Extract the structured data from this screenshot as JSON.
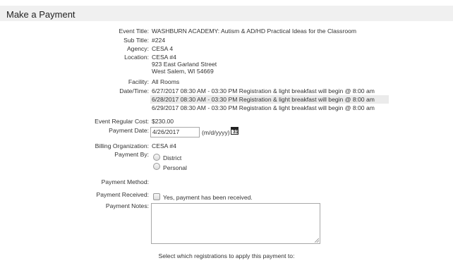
{
  "page": {
    "title": "Make a Payment"
  },
  "fields": {
    "event_title": {
      "label": "Event Title:",
      "value": "WASHBURN ACADEMY: Autism & AD/HD Practical Ideas for the Classroom"
    },
    "sub_title": {
      "label": "Sub Title:",
      "value": "#224"
    },
    "agency": {
      "label": "Agency:",
      "value": "CESA 4"
    },
    "location": {
      "label": "Location:",
      "lines": [
        "CESA #4",
        "923 East Garland Street",
        "West Salem, WI 54669"
      ]
    },
    "facility": {
      "label": "Facility:",
      "value": "All Rooms"
    },
    "datetime": {
      "label": "Date/Time:",
      "rows": [
        "6/27/2017 08:30 AM - 03:30 PM Registration & light breakfast will begin @ 8:00 am",
        "6/28/2017 08:30 AM - 03:30 PM Registration & light breakfast will begin @ 8:00 am",
        "6/29/2017 08:30 AM - 03:30 PM Registration & light breakfast will begin @ 8:00 am"
      ]
    },
    "regular_cost": {
      "label": "Event Regular Cost:",
      "value": "$230.00"
    },
    "payment_date": {
      "label": "Payment Date:",
      "value": "4/26/2017",
      "format_hint": "(m/d/yyyy)",
      "calendar_icon": "calendar-icon",
      "calendar_digit": "31"
    },
    "billing_org": {
      "label": "Billing Organization:",
      "value": "CESA #4"
    },
    "payment_by": {
      "label": "Payment By:",
      "options": [
        "District",
        "Personal"
      ]
    },
    "payment_method": {
      "label": "Payment Method:"
    },
    "payment_received": {
      "label": "Payment Received:",
      "checkbox_label": "Yes, payment has been received."
    },
    "payment_notes": {
      "label": "Payment Notes:",
      "value": ""
    }
  },
  "footer": {
    "text": "Select which registrations to apply this payment to:"
  }
}
